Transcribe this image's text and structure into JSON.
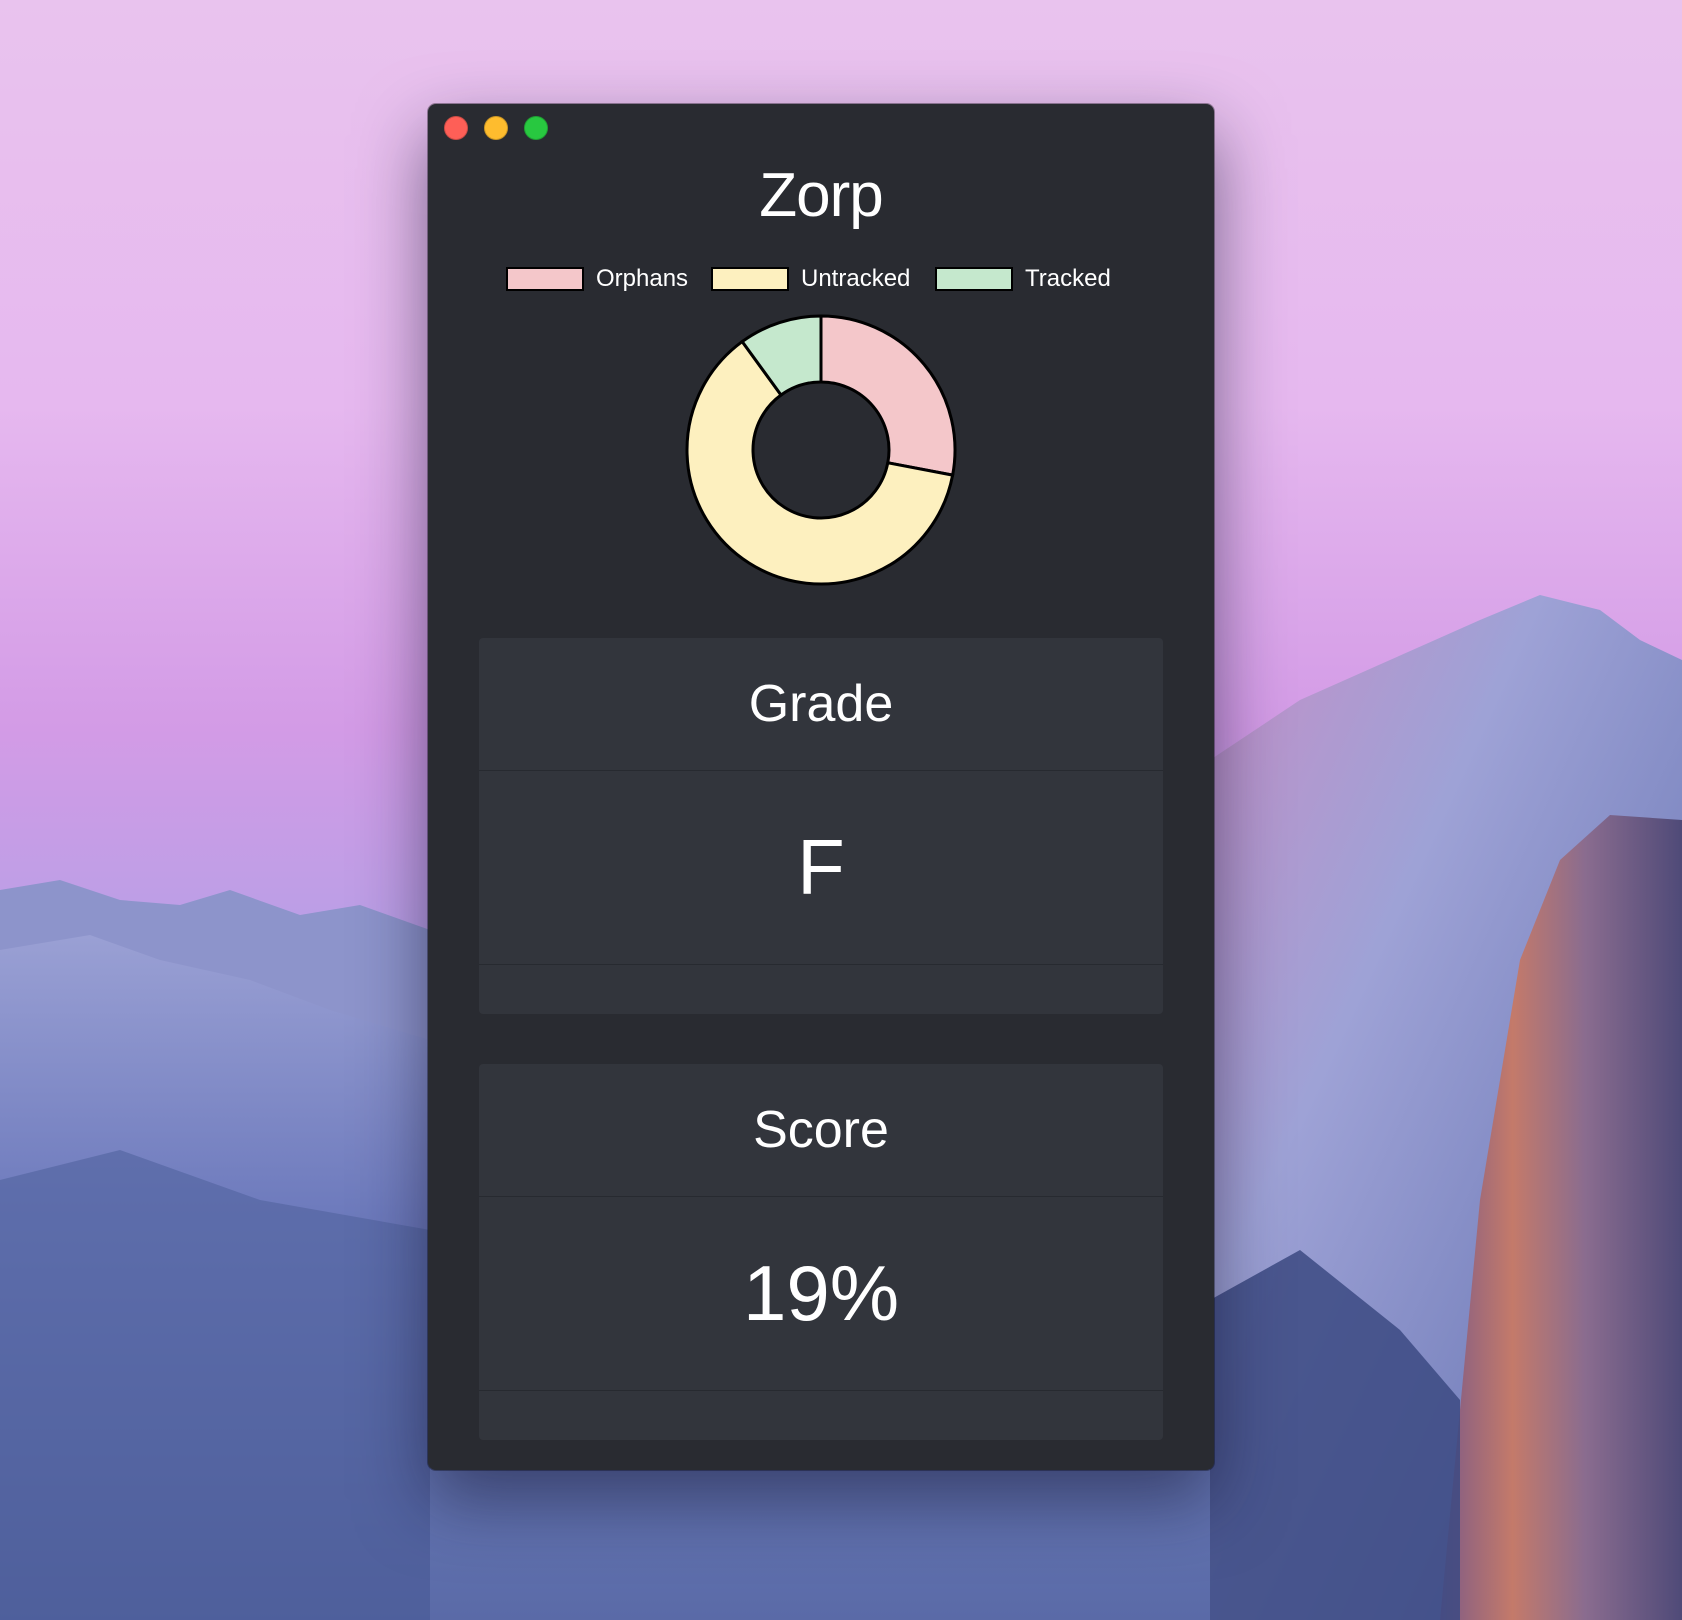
{
  "window": {
    "title": "Zorp",
    "controls": [
      "close",
      "minimize",
      "maximize"
    ]
  },
  "chart_data": {
    "type": "pie",
    "legend": [
      "Orphans",
      "Untracked",
      "Tracked"
    ],
    "legend_position": "top",
    "values": [
      28,
      62,
      10
    ],
    "colors": [
      "#f4c7ca",
      "#fdf0bf",
      "#c5e8cd"
    ]
  },
  "cards": {
    "grade": {
      "title": "Grade",
      "value": "F"
    },
    "score": {
      "title": "Score",
      "value": "19%"
    }
  }
}
